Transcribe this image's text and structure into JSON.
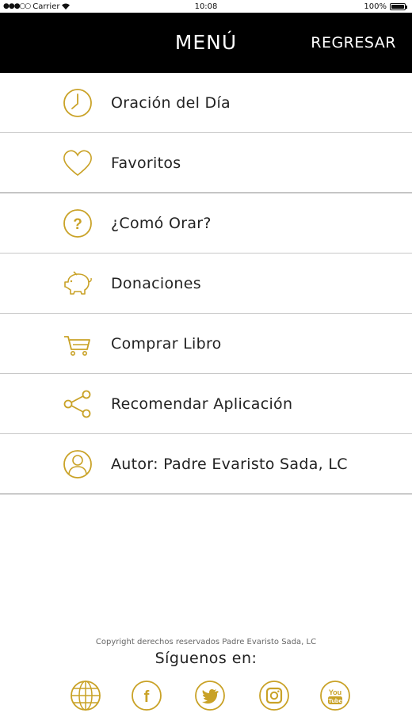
{
  "status_bar": {
    "carrier": "Carrier",
    "time": "10:08",
    "battery": "100%",
    "battery_level": 1.0
  },
  "header": {
    "title": "MENÚ",
    "back_label": "REGRESAR"
  },
  "menu": {
    "items": [
      {
        "label": "Oración del Día",
        "icon": "clock-icon"
      },
      {
        "label": "Favoritos",
        "icon": "heart-icon"
      },
      {
        "label": "¿Comó Orar?",
        "icon": "question-icon"
      },
      {
        "label": "Donaciones",
        "icon": "piggy-bank-icon"
      },
      {
        "label": "Comprar Libro",
        "icon": "cart-icon"
      },
      {
        "label": "Recomendar Aplicación",
        "icon": "share-icon"
      },
      {
        "label": "Autor: Padre Evaristo Sada, LC",
        "icon": "user-icon"
      }
    ]
  },
  "footer": {
    "copyright": "Copyright derechos reservados Padre Evaristo Sada, LC",
    "follow_label": "Síguenos en:",
    "social": [
      {
        "name": "website",
        "icon": "globe-icon"
      },
      {
        "name": "facebook",
        "icon": "facebook-icon",
        "glyph": "f"
      },
      {
        "name": "twitter",
        "icon": "twitter-icon"
      },
      {
        "name": "instagram",
        "icon": "instagram-icon"
      },
      {
        "name": "youtube",
        "icon": "youtube-icon",
        "glyph_top": "You",
        "glyph_bottom": "Tube"
      }
    ]
  },
  "colors": {
    "accent_gold": "#c9a227",
    "header_bg": "#000000",
    "header_text": "#ffffff"
  }
}
